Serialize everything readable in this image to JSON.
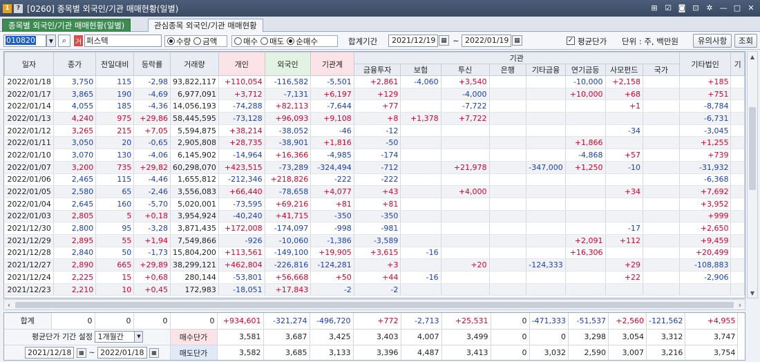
{
  "window": {
    "badge1": "1",
    "badge2": "?",
    "title": "[0260] 종목별 외국인/기관 매매현황(일별)",
    "icons": [
      "pin-icon",
      "checkbox-icon",
      "camera-icon",
      "lock-icon",
      "gear-icon",
      "minimize-icon",
      "maximize-icon",
      "close-icon"
    ]
  },
  "tabs": {
    "active": "종목별 외국인/기관 매매현황(일별)",
    "inactive": "관심종목 외국인/기관 매매현황"
  },
  "toolbar": {
    "stock_code": "010820",
    "stock_badge": "거",
    "stock_name": "퍼스텍",
    "radio_qty": "수량",
    "radio_amt": "금액",
    "radio_buy": "매수",
    "radio_sell": "매도",
    "radio_net": "순매수",
    "period_label": "합계기간",
    "date_from": "2021/12/19",
    "tilde": "~",
    "date_to": "2022/01/19",
    "avg_label": "평균단가",
    "unit_label": "단위 : 주, 백만원",
    "notice_btn": "유의사항",
    "query_btn": "조회"
  },
  "headers": {
    "date": "일자",
    "close": "종가",
    "change": "전일대비",
    "rate": "등락률",
    "volume": "거래량",
    "individual": "개인",
    "foreign": "외국인",
    "inst_total": "기관계",
    "inst_group": "기관",
    "fin_invest": "금융투자",
    "insurance": "보험",
    "trust": "투신",
    "bank": "은행",
    "other_fin": "기타금융",
    "pension": "연기금등",
    "pef": "사모펀드",
    "nation": "국가",
    "other_corp": "기타법인",
    "more": "기"
  },
  "rows": [
    {
      "date": "2022/01/18",
      "close": "3,750",
      "change": "115",
      "rate": "-2,98",
      "vol": "93,822,117",
      "ind": "+110,054",
      "frn": "-116,582",
      "inst": "-5,501",
      "fin": "+2,861",
      "ins": "-4,060",
      "trust": "+3,540",
      "bank": "",
      "ofin": "",
      "pen": "-10,000",
      "pef": "+2,158",
      "nat": "",
      "ocorp": "+185",
      "dir": "down"
    },
    {
      "date": "2022/01/17",
      "close": "3,865",
      "change": "190",
      "rate": "-4,69",
      "vol": "6,977,091",
      "ind": "+3,712",
      "frn": "-7,131",
      "inst": "+6,197",
      "fin": "+129",
      "ins": "",
      "trust": "-4,000",
      "bank": "",
      "ofin": "",
      "pen": "+10,000",
      "pef": "+68",
      "nat": "",
      "ocorp": "+751",
      "dir": "down"
    },
    {
      "date": "2022/01/14",
      "close": "4,055",
      "change": "185",
      "rate": "-4,36",
      "vol": "14,056,193",
      "ind": "-74,288",
      "frn": "+82,113",
      "inst": "-7,644",
      "fin": "+77",
      "ins": "",
      "trust": "-7,722",
      "bank": "",
      "ofin": "",
      "pen": "",
      "pef": "+1",
      "nat": "",
      "ocorp": "-8,784",
      "dir": "down"
    },
    {
      "date": "2022/01/13",
      "close": "4,240",
      "change": "975",
      "rate": "+29,86",
      "vol": "58,445,595",
      "ind": "-73,128",
      "frn": "+96,093",
      "inst": "+9,108",
      "fin": "+8",
      "ins": "+1,378",
      "trust": "+7,722",
      "bank": "",
      "ofin": "",
      "pen": "",
      "pef": "",
      "nat": "",
      "ocorp": "-6,731",
      "dir": "up"
    },
    {
      "date": "2022/01/12",
      "close": "3,265",
      "change": "215",
      "rate": "+7,05",
      "vol": "5,594,875",
      "ind": "+38,214",
      "frn": "-38,052",
      "inst": "-46",
      "fin": "-12",
      "ins": "",
      "trust": "",
      "bank": "",
      "ofin": "",
      "pen": "",
      "pef": "-34",
      "nat": "",
      "ocorp": "-3,045",
      "dir": "up"
    },
    {
      "date": "2022/01/11",
      "close": "3,050",
      "change": "20",
      "rate": "-0,65",
      "vol": "2,905,808",
      "ind": "+28,735",
      "frn": "-38,901",
      "inst": "+1,816",
      "fin": "-50",
      "ins": "",
      "trust": "",
      "bank": "",
      "ofin": "",
      "pen": "+1,866",
      "pef": "",
      "nat": "",
      "ocorp": "+1,255",
      "dir": "down"
    },
    {
      "date": "2022/01/10",
      "close": "3,070",
      "change": "130",
      "rate": "-4,06",
      "vol": "6,145,902",
      "ind": "-14,964",
      "frn": "+16,366",
      "inst": "-4,985",
      "fin": "-174",
      "ins": "",
      "trust": "",
      "bank": "",
      "ofin": "",
      "pen": "-4,868",
      "pef": "+57",
      "nat": "",
      "ocorp": "+739",
      "dir": "down"
    },
    {
      "date": "2022/01/07",
      "close": "3,200",
      "change": "735",
      "rate": "+29,82",
      "vol": "60,298,070",
      "ind": "+423,515",
      "frn": "-73,289",
      "inst": "-324,494",
      "fin": "-712",
      "ins": "",
      "trust": "+21,978",
      "bank": "",
      "ofin": "-347,000",
      "pen": "+1,250",
      "pef": "-10",
      "nat": "",
      "ocorp": "-31,932",
      "dir": "up"
    },
    {
      "date": "2022/01/06",
      "close": "2,465",
      "change": "115",
      "rate": "-4,46",
      "vol": "1,655,812",
      "ind": "-212,346",
      "frn": "+218,826",
      "inst": "-222",
      "fin": "-222",
      "ins": "",
      "trust": "",
      "bank": "",
      "ofin": "",
      "pen": "",
      "pef": "",
      "nat": "",
      "ocorp": "-6,368",
      "dir": "down"
    },
    {
      "date": "2022/01/05",
      "close": "2,580",
      "change": "65",
      "rate": "-2,46",
      "vol": "3,556,083",
      "ind": "+66,440",
      "frn": "-78,658",
      "inst": "+4,077",
      "fin": "+43",
      "ins": "",
      "trust": "+4,000",
      "bank": "",
      "ofin": "",
      "pen": "",
      "pef": "+34",
      "nat": "",
      "ocorp": "+7,692",
      "dir": "down"
    },
    {
      "date": "2022/01/04",
      "close": "2,645",
      "change": "160",
      "rate": "-5,70",
      "vol": "5,020,001",
      "ind": "-73,595",
      "frn": "+69,216",
      "inst": "+81",
      "fin": "+81",
      "ins": "",
      "trust": "",
      "bank": "",
      "ofin": "",
      "pen": "",
      "pef": "",
      "nat": "",
      "ocorp": "+3,952",
      "dir": "down"
    },
    {
      "date": "2022/01/03",
      "close": "2,805",
      "change": "5",
      "rate": "+0,18",
      "vol": "3,954,924",
      "ind": "-40,240",
      "frn": "+41,715",
      "inst": "-350",
      "fin": "-350",
      "ins": "",
      "trust": "",
      "bank": "",
      "ofin": "",
      "pen": "",
      "pef": "",
      "nat": "",
      "ocorp": "+999",
      "dir": "up"
    },
    {
      "date": "2021/12/30",
      "close": "2,800",
      "change": "95",
      "rate": "-3,28",
      "vol": "3,871,435",
      "ind": "+172,008",
      "frn": "-174,097",
      "inst": "-998",
      "fin": "-981",
      "ins": "",
      "trust": "",
      "bank": "",
      "ofin": "",
      "pen": "",
      "pef": "-17",
      "nat": "",
      "ocorp": "+2,650",
      "dir": "down"
    },
    {
      "date": "2021/12/29",
      "close": "2,895",
      "change": "55",
      "rate": "+1,94",
      "vol": "7,549,866",
      "ind": "-926",
      "frn": "-10,060",
      "inst": "-1,386",
      "fin": "-3,589",
      "ins": "",
      "trust": "",
      "bank": "",
      "ofin": "",
      "pen": "+2,091",
      "pef": "+112",
      "nat": "",
      "ocorp": "+9,459",
      "dir": "up"
    },
    {
      "date": "2021/12/28",
      "close": "2,840",
      "change": "50",
      "rate": "-1,73",
      "vol": "15,804,200",
      "ind": "+113,561",
      "frn": "-149,100",
      "inst": "+19,905",
      "fin": "+3,615",
      "ins": "-16",
      "trust": "",
      "bank": "",
      "ofin": "",
      "pen": "+16,306",
      "pef": "",
      "nat": "",
      "ocorp": "+20,499",
      "dir": "down"
    },
    {
      "date": "2021/12/27",
      "close": "2,890",
      "change": "665",
      "rate": "+29,89",
      "vol": "38,299,121",
      "ind": "+462,804",
      "frn": "-226,816",
      "inst": "-124,281",
      "fin": "+3",
      "ins": "",
      "trust": "+20",
      "bank": "",
      "ofin": "-124,333",
      "pen": "",
      "pef": "+29",
      "nat": "",
      "ocorp": "-108,883",
      "dir": "up"
    },
    {
      "date": "2021/12/24",
      "close": "2,225",
      "change": "15",
      "rate": "+0,68",
      "vol": "280,144",
      "ind": "-53,801",
      "frn": "+56,668",
      "inst": "+50",
      "fin": "+44",
      "ins": "-16",
      "trust": "",
      "bank": "",
      "ofin": "",
      "pen": "",
      "pef": "+22",
      "nat": "",
      "ocorp": "-2,906",
      "dir": "up"
    },
    {
      "date": "2021/12/23",
      "close": "2,210",
      "change": "10",
      "rate": "+0,45",
      "vol": "172,983",
      "ind": "-18,051",
      "frn": "+17,843",
      "inst": "-2",
      "fin": "-2",
      "ins": "",
      "trust": "",
      "bank": "",
      "ofin": "",
      "pen": "",
      "pef": "",
      "nat": "",
      "ocorp": "",
      "dir": "up"
    }
  ],
  "summary": {
    "total_label": "합계",
    "close": "0",
    "change": "0",
    "rate": "0",
    "vol": "0",
    "ind": "+934,601",
    "frn": "-321,274",
    "inst": "-496,720",
    "fin": "+772",
    "ins": "-2,713",
    "trust": "+25,531",
    "bank": "0",
    "ofin": "-471,333",
    "pen": "-51,537",
    "pef": "+2,560",
    "nat": "-121,562",
    "ocorp": "+4,955"
  },
  "avg": {
    "period_label": "평균단가 기간 설정",
    "period_value": "1개월간",
    "date_from": "2021/12/18",
    "tilde": "~",
    "date_to": "2022/01/18",
    "buy_label": "매수단가",
    "sell_label": "매도단가",
    "buy": {
      "ind": "3,581",
      "frn": "3,687",
      "inst": "3,425",
      "fin": "3,403",
      "ins": "4,007",
      "trust": "3,499",
      "bank": "0",
      "ofin": "0",
      "pen": "3,298",
      "pef": "3,054",
      "nat": "3,312",
      "ocorp": "3,747"
    },
    "sell": {
      "ind": "3,582",
      "frn": "3,685",
      "inst": "3,133",
      "fin": "3,396",
      "ins": "4,487",
      "trust": "3,413",
      "bank": "0",
      "ofin": "3,032",
      "pen": "2,590",
      "pef": "3,007",
      "nat": "3,216",
      "ocorp": "3,754"
    }
  },
  "colors": {
    "up": "#e0002a",
    "down": "#1a40c0",
    "active_tab": "#3d8a52"
  }
}
